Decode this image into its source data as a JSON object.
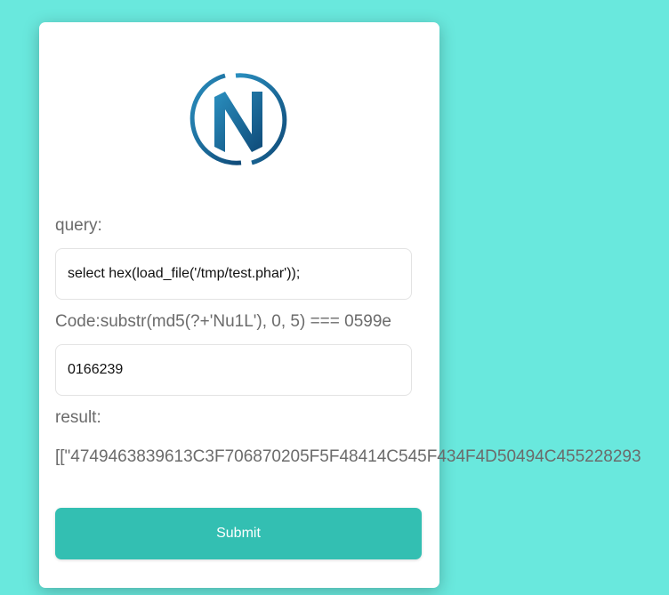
{
  "form": {
    "logo_icon": "n-circle-logo-icon",
    "query_label": "query:",
    "query_value": "select hex(load_file('/tmp/test.phar'));",
    "code_label": "Code:substr(md5(?+'Nu1L'), 0, 5) === 0599e",
    "code_value": "0166239",
    "result_label": "result:",
    "result_value": "[[\"4749463839613C3F706870205F5F48414C545F434F4D50494C455228293",
    "submit_label": "Submit"
  },
  "colors": {
    "background": "#69e8dd",
    "card": "#ffffff",
    "button": "#33bfb2",
    "logo": "#1a5f8c"
  }
}
